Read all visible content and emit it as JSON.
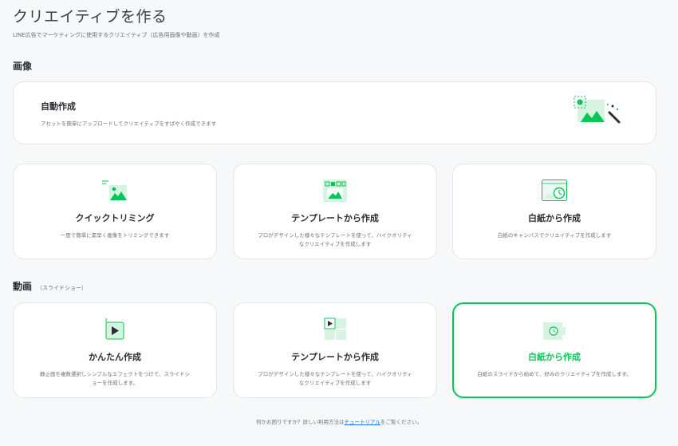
{
  "header": {
    "title": "クリエイティブを作る",
    "subtitle": "LINE広告でマーケティングに使用するクリエイティブ（広告用画像や動画）を作成"
  },
  "image_section": {
    "title": "画像",
    "auto": {
      "title": "自動作成",
      "desc": "アセットを簡単にアップロードしてクリエイティブをすばやく作成できます",
      "icon": "magic-image-icon"
    },
    "cards": [
      {
        "title": "クイックトリミング",
        "desc": "一度で簡単に素早く画像をトリミングできます",
        "icon": "crop-image-icon"
      },
      {
        "title": "テンプレートから作成",
        "desc": "プロがデザインした様々なテンプレートを使って、ハイクオリティなクリエイティブを作成します",
        "icon": "template-image-icon"
      },
      {
        "title": "白紙から作成",
        "desc": "白紙のキャンバスでクリエイティブを作成します",
        "icon": "blank-canvas-icon"
      }
    ]
  },
  "video_section": {
    "title": "動画",
    "note": "（スライドショー）",
    "cards": [
      {
        "title": "かんたん作成",
        "desc": "静止画を複数選択しシンプルなエフェクトをつけて、スライドショーを作成します。",
        "icon": "easy-video-icon"
      },
      {
        "title": "テンプレートから作成",
        "desc": "プロがデザインした様々なテンプレートを使って、ハイクオリティなクリエイティブを作成します",
        "icon": "template-video-icon"
      },
      {
        "title": "白紙から作成",
        "desc": "白紙のスライドから始めて、好みのクリエイティブを作成します。",
        "icon": "blank-video-icon",
        "selected": true
      }
    ]
  },
  "footer": {
    "prefix": "何かお困りですか？詳しい利用方法は",
    "link": "チュートリアル",
    "suffix": "をご覧ください。"
  },
  "colors": {
    "accent": "#06c755",
    "accent_light": "#d7f3e2"
  }
}
